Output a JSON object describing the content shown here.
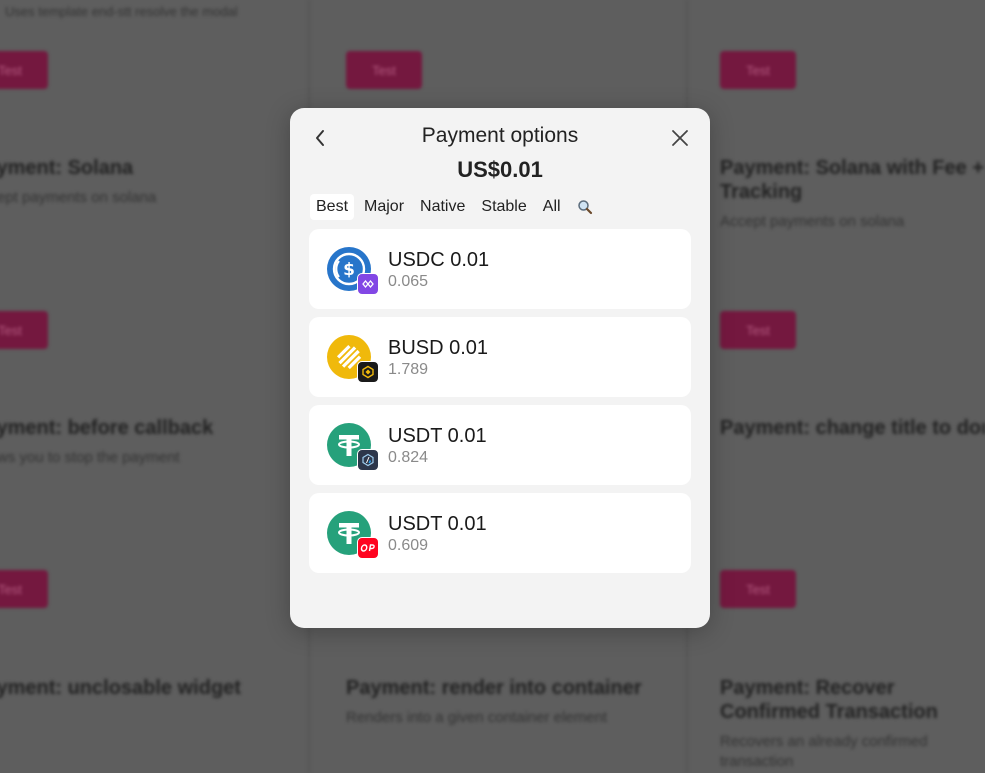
{
  "background": {
    "top_text": "Uses template end-stt resolve the modal",
    "button_label": "Test",
    "cards": [
      {
        "title": "Payment: Solana",
        "desc": "Accept payments on solana"
      },
      {
        "title": "Payment: Solana with Fee + Tracking",
        "desc": "Accept payments on solana"
      },
      {
        "title": "Payment: before callback",
        "desc": "Allows you to stop the payment"
      },
      {
        "title": "Payment: change title to donate",
        "desc": ""
      },
      {
        "title": "Payment: unclosable widget",
        "desc": ""
      },
      {
        "title": "Payment: render into container",
        "desc": "Renders into a given container element"
      },
      {
        "title": "Payment: Recover Confirmed Transaction",
        "desc": "Recovers an already confirmed transaction"
      }
    ]
  },
  "modal": {
    "title": "Payment options",
    "amount": "US$0.01",
    "tabs": [
      "Best",
      "Major",
      "Native",
      "Stable",
      "All"
    ],
    "active_tab": "Best",
    "tokens": [
      {
        "name": "USDC 0.01",
        "balance": "0.065",
        "token_icon": "usdc-icon",
        "chain_icon": "polygon-icon",
        "token_color": "#2775ca",
        "chain_color": "#8247e5"
      },
      {
        "name": "BUSD 0.01",
        "balance": "1.789",
        "token_icon": "busd-icon",
        "chain_icon": "bnb-chain-icon",
        "token_color": "#f0b90b",
        "chain_color": "#1a1a1a"
      },
      {
        "name": "USDT 0.01",
        "balance": "0.824",
        "token_icon": "usdt-icon",
        "chain_icon": "arbitrum-icon",
        "token_color": "#26a17b",
        "chain_color": "#2d374b"
      },
      {
        "name": "USDT 0.01",
        "balance": "0.609",
        "token_icon": "usdt-icon",
        "chain_icon": "optimism-icon",
        "token_color": "#26a17b",
        "chain_color": "#ff0420"
      }
    ]
  }
}
